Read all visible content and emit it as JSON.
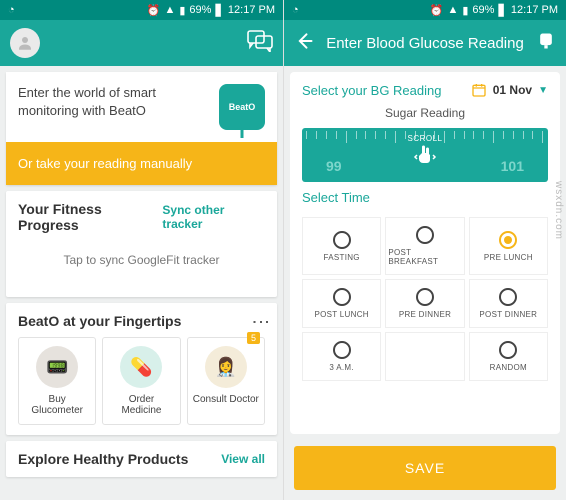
{
  "statusbar": {
    "battery": "69%",
    "time": "12:17 PM"
  },
  "screen1": {
    "hero_text": "Enter the world of smart monitoring with BeatO",
    "hero_badge": "BeatO",
    "orange_cta": "Or take your reading manually",
    "fitness": {
      "title": "Your Fitness Progress",
      "link": "Sync other tracker",
      "body": "Tap to sync GoogleFit tracker"
    },
    "fingertips": {
      "title": "BeatO at your Fingertips",
      "tiles": [
        {
          "label": "Buy Glucometer"
        },
        {
          "label": "Order Medicine"
        },
        {
          "label": "Consult Doctor",
          "badge": "5"
        }
      ]
    },
    "explore": {
      "title": "Explore Healthy Products",
      "link": "View all"
    }
  },
  "screen2": {
    "title": "Enter Blood Glucose Reading",
    "select_label": "Select your BG Reading",
    "date": "01 Nov",
    "sugar_title": "Sugar Reading",
    "scroll_label": "SCROLL",
    "ruler_left": "99",
    "ruler_right": "101",
    "select_time_label": "Select Time",
    "times": [
      {
        "label": "FASTING",
        "selected": false
      },
      {
        "label": "POST BREAKFAST",
        "selected": false
      },
      {
        "label": "PRE LUNCH",
        "selected": true
      },
      {
        "label": "POST LUNCH",
        "selected": false
      },
      {
        "label": "PRE DINNER",
        "selected": false
      },
      {
        "label": "POST DINNER",
        "selected": false
      },
      {
        "label": "3 A.M.",
        "selected": false
      },
      {
        "label": "",
        "selected": false,
        "empty": true
      },
      {
        "label": "RANDOM",
        "selected": false
      }
    ],
    "save": "SAVE"
  },
  "watermark": "wsxdn.com"
}
